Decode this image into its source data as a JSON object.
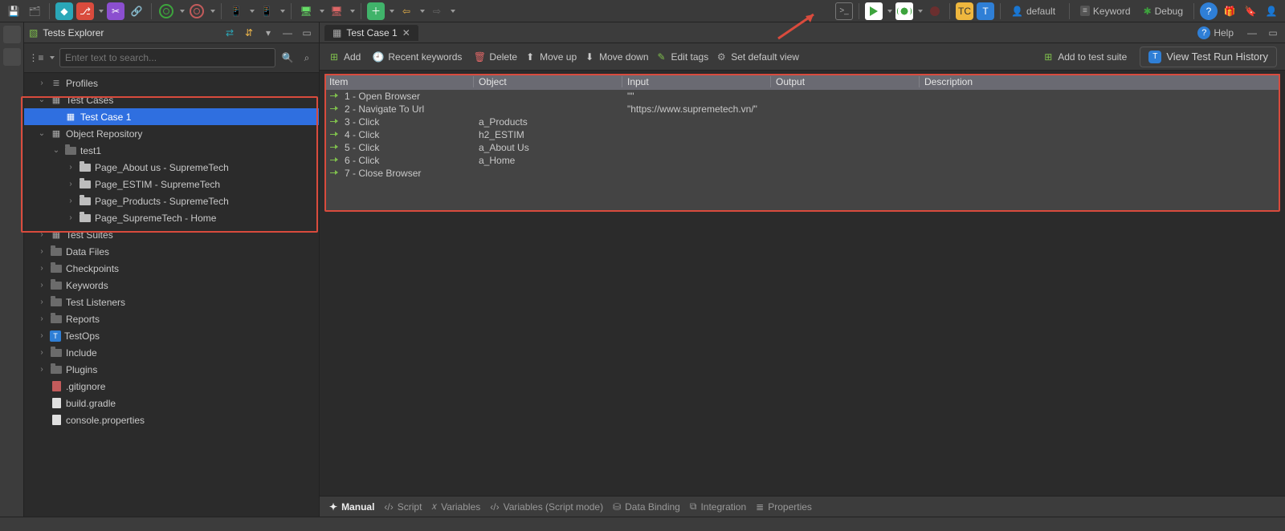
{
  "toolbar": {
    "profile_label": "default",
    "keyword_label": "Keyword",
    "debug_label": "Debug"
  },
  "explorer": {
    "title": "Tests Explorer",
    "search_placeholder": "Enter text to search...",
    "nodes": {
      "profiles": "Profiles",
      "test_cases": "Test Cases",
      "test_case_1": "Test Case 1",
      "object_repo": "Object Repository",
      "test1": "test1",
      "page_about": "Page_About us - SupremeTech",
      "page_estim": "Page_ESTIM - SupremeTech",
      "page_products": "Page_Products - SupremeTech",
      "page_home": "Page_SupremeTech - Home",
      "test_suites": "Test Suites",
      "data_files": "Data Files",
      "checkpoints": "Checkpoints",
      "keywords": "Keywords",
      "test_listeners": "Test Listeners",
      "reports": "Reports",
      "testops": "TestOps",
      "include": "Include",
      "plugins": "Plugins",
      "gitignore": ".gitignore",
      "build_gradle": "build.gradle",
      "console_props": "console.properties"
    }
  },
  "editor": {
    "tab_label": "Test Case 1",
    "help_label": "Help",
    "actions": {
      "add": "Add",
      "recent": "Recent keywords",
      "delete": "Delete",
      "move_up": "Move up",
      "move_down": "Move down",
      "edit_tags": "Edit tags",
      "set_default": "Set default view",
      "add_suite": "Add to test suite",
      "view_history": "View Test Run History"
    },
    "columns": {
      "item": "Item",
      "object": "Object",
      "input": "Input",
      "output": "Output",
      "description": "Description"
    },
    "steps": [
      {
        "item": "1 - Open Browser",
        "object": "",
        "input": "\"\""
      },
      {
        "item": "2 - Navigate To Url",
        "object": "",
        "input": "\"https://www.supremetech.vn/\""
      },
      {
        "item": "3 - Click",
        "object": "a_Products",
        "input": ""
      },
      {
        "item": "4 - Click",
        "object": "h2_ESTIM",
        "input": ""
      },
      {
        "item": "5 - Click",
        "object": "a_About Us",
        "input": ""
      },
      {
        "item": "6 - Click",
        "object": "a_Home",
        "input": ""
      },
      {
        "item": "7 - Close Browser",
        "object": "",
        "input": ""
      }
    ],
    "bottom_tabs": {
      "manual": "Manual",
      "script": "Script",
      "variables": "Variables",
      "variables_script": "Variables (Script mode)",
      "data_binding": "Data Binding",
      "integration": "Integration",
      "properties": "Properties"
    }
  }
}
